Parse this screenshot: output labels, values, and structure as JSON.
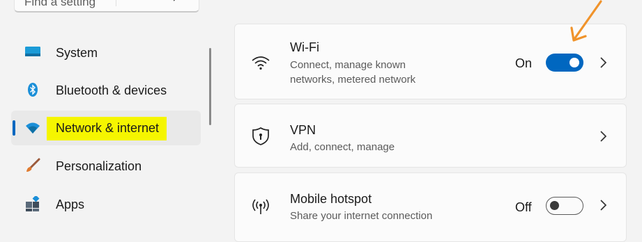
{
  "search": {
    "placeholder": "Find a setting"
  },
  "sidebar": {
    "items": [
      {
        "label": "System",
        "icon": "system-icon"
      },
      {
        "label": "Bluetooth & devices",
        "icon": "bluetooth-icon"
      },
      {
        "label": "Network & internet",
        "icon": "network-icon",
        "selected": true
      },
      {
        "label": "Personalization",
        "icon": "paintbrush-icon"
      },
      {
        "label": "Apps",
        "icon": "apps-icon"
      }
    ]
  },
  "cards": {
    "wifi": {
      "title": "Wi-Fi",
      "subtitle_line1": "Connect, manage known",
      "subtitle_line2": "networks, metered network",
      "state": "On",
      "toggle_on": true,
      "icon": "wifi-icon"
    },
    "vpn": {
      "title": "VPN",
      "subtitle": "Add, connect, manage",
      "icon": "shield-icon"
    },
    "hotspot": {
      "title": "Mobile hotspot",
      "subtitle": "Share your internet connection",
      "state": "Off",
      "toggle_on": false,
      "icon": "hotspot-icon"
    }
  },
  "colors": {
    "accent": "#0067c0",
    "highlight": "#f5f500",
    "annotation_arrow": "#f0932b"
  }
}
